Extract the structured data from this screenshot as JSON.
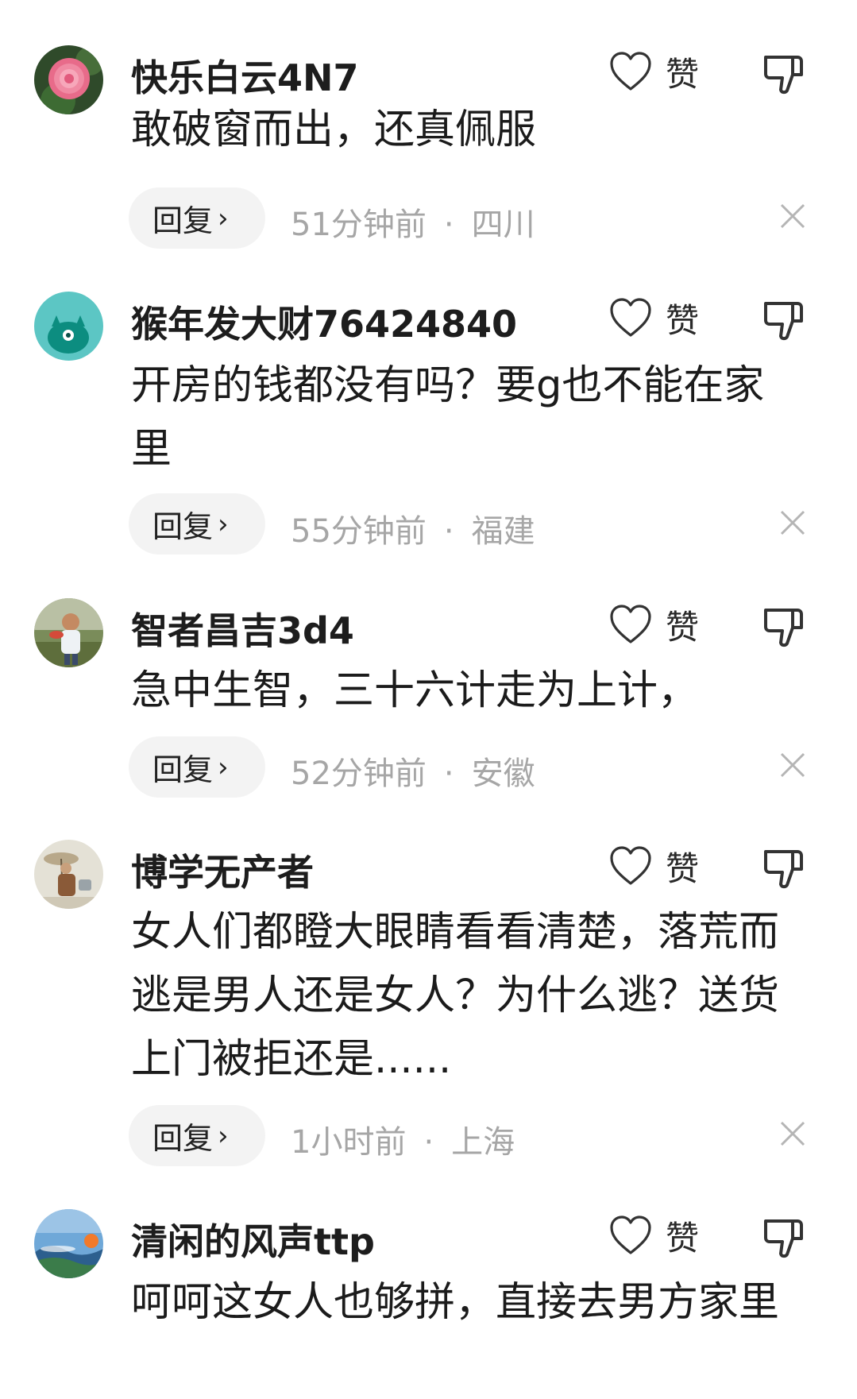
{
  "comments": [
    {
      "username": "快乐白云4N7",
      "text": "敢破窗而出，还真佩服",
      "like_label": "赞",
      "reply_label": "回复",
      "time": "51分钟前",
      "separator": "·",
      "location": "四川",
      "avatar_icon": "rose-avatar"
    },
    {
      "username": "猴年发大财76424840",
      "text": "开房的钱都没有吗？要g也不能在家里",
      "like_label": "赞",
      "reply_label": "回复",
      "time": "55分钟前",
      "separator": "·",
      "location": "福建",
      "avatar_icon": "teal-cat-avatar"
    },
    {
      "username": "智者昌吉3d4",
      "text": "急中生智，三十六计走为上计，",
      "like_label": "赞",
      "reply_label": "回复",
      "time": "52分钟前",
      "separator": "·",
      "location": "安徽",
      "avatar_icon": "child-photo-avatar"
    },
    {
      "username": "博学无产者",
      "text": "女人们都瞪大眼睛看看清楚，落荒而逃是男人还是女人？为什么逃？送货上门被拒还是......",
      "like_label": "赞",
      "reply_label": "回复",
      "time": "1小时前",
      "separator": "·",
      "location": "上海",
      "avatar_icon": "painting-avatar"
    },
    {
      "username": "清闲的风声ttp",
      "text": "呵呵这女人也够拼，直接去男方家里",
      "like_label": "赞",
      "avatar_icon": "landscape-avatar"
    }
  ],
  "colors": {
    "text": "#1b1b1b",
    "meta": "#a6a6a6",
    "reply_bg": "#f3f3f3",
    "icon": "#333333"
  }
}
